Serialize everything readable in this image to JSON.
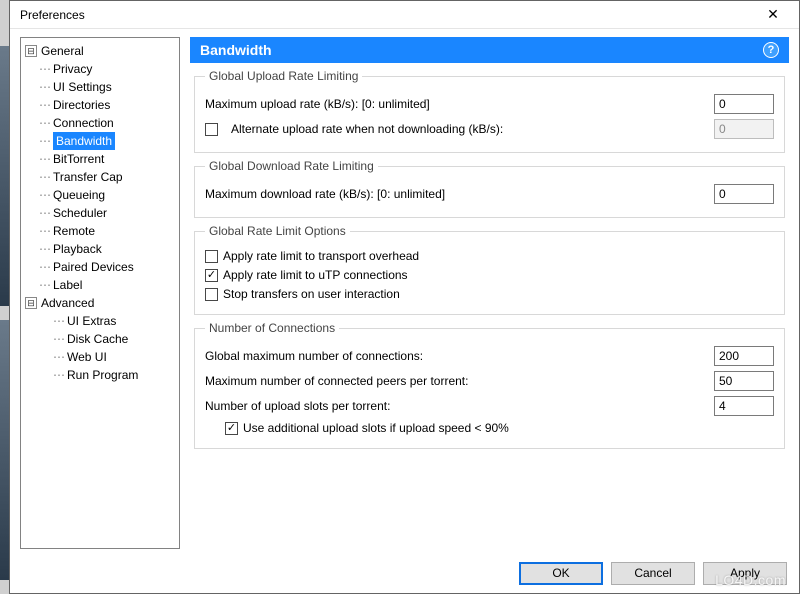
{
  "window": {
    "title": "Preferences",
    "close_glyph": "✕"
  },
  "tree": {
    "root_expander": "⊟",
    "items": [
      {
        "label": "General"
      },
      {
        "label": "Privacy"
      },
      {
        "label": "UI Settings"
      },
      {
        "label": "Directories"
      },
      {
        "label": "Connection"
      },
      {
        "label": "Bandwidth",
        "selected": true
      },
      {
        "label": "BitTorrent"
      },
      {
        "label": "Transfer Cap"
      },
      {
        "label": "Queueing"
      },
      {
        "label": "Scheduler"
      },
      {
        "label": "Remote"
      },
      {
        "label": "Playback"
      },
      {
        "label": "Paired Devices"
      },
      {
        "label": "Label"
      }
    ],
    "advanced": {
      "label": "Advanced",
      "expander": "⊟",
      "children": [
        {
          "label": "UI Extras"
        },
        {
          "label": "Disk Cache"
        },
        {
          "label": "Web UI"
        },
        {
          "label": "Run Program"
        }
      ]
    }
  },
  "panel": {
    "title": "Bandwidth",
    "help_glyph": "?",
    "groups": {
      "upload": {
        "legend": "Global Upload Rate Limiting",
        "max_label": "Maximum upload rate (kB/s): [0: unlimited]",
        "max_value": "0",
        "alt_checked": false,
        "alt_label": "Alternate upload rate when not downloading (kB/s):",
        "alt_value": "0"
      },
      "download": {
        "legend": "Global Download Rate Limiting",
        "max_label": "Maximum download rate (kB/s): [0: unlimited]",
        "max_value": "0"
      },
      "options": {
        "legend": "Global Rate Limit Options",
        "overhead_checked": false,
        "overhead_label": "Apply rate limit to transport overhead",
        "utp_checked": true,
        "utp_label": "Apply rate limit to uTP connections",
        "stop_checked": false,
        "stop_label": "Stop transfers on user interaction"
      },
      "connections": {
        "legend": "Number of Connections",
        "global_label": "Global maximum number of connections:",
        "global_value": "200",
        "peers_label": "Maximum number of connected peers per torrent:",
        "peers_value": "50",
        "slots_label": "Number of upload slots per torrent:",
        "slots_value": "4",
        "add_slots_checked": true,
        "add_slots_label": "Use additional upload slots if upload speed < 90%"
      }
    }
  },
  "footer": {
    "ok": "OK",
    "cancel": "Cancel",
    "apply": "Apply"
  },
  "watermark": "LO4D.com"
}
